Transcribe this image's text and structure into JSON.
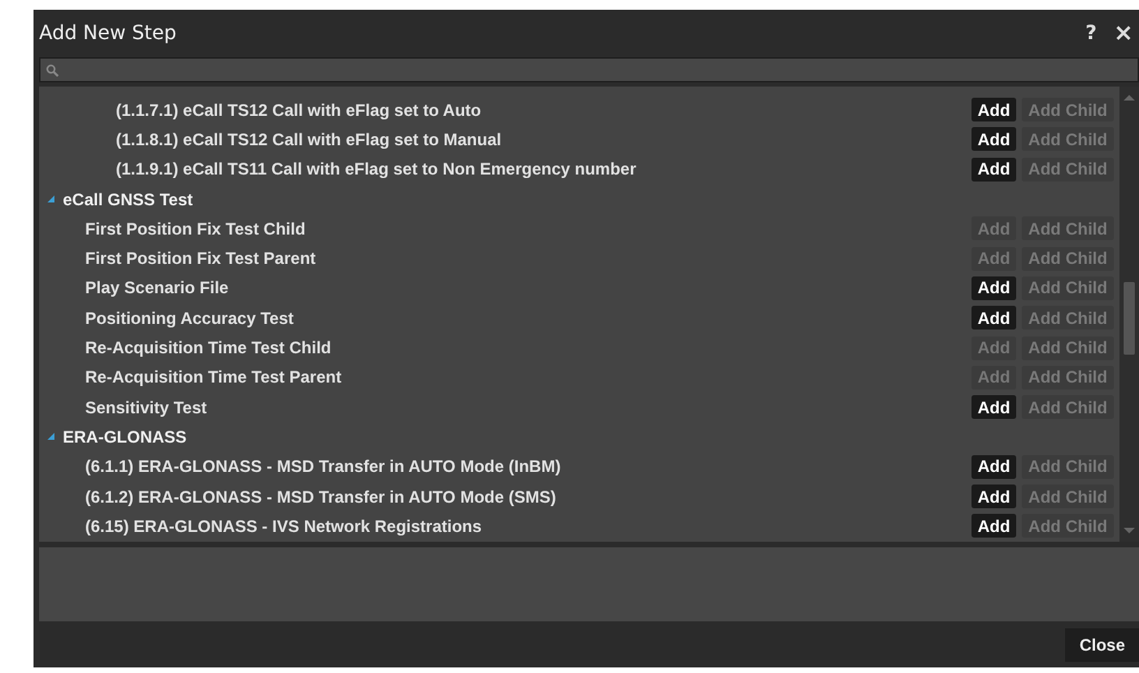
{
  "window": {
    "title": "Add New Step",
    "help": "?",
    "close": "×"
  },
  "tree": [
    {
      "children": [
        {
          "label": "(1.1.7.1) eCall TS12 Call with eFlag set to Auto",
          "add": "Add",
          "add_child": "Add Child",
          "add_disabled": false
        },
        {
          "label": "(1.1.8.1) eCall TS12 Call with eFlag set to Manual",
          "add": "Add",
          "add_child": "Add Child",
          "add_disabled": false
        },
        {
          "label": "(1.1.9.1) eCall TS11 Call with eFlag set to Non Emergency number",
          "add": "Add",
          "add_child": "Add Child",
          "add_disabled": false
        }
      ]
    },
    {
      "label": "eCall GNSS Test",
      "expanded": true,
      "children": [
        {
          "label": "First Position Fix Test Child",
          "add": "Add",
          "add_child": "Add Child",
          "add_disabled": true
        },
        {
          "label": "First Position Fix Test Parent",
          "add": "Add",
          "add_child": "Add Child",
          "add_disabled": true
        },
        {
          "label": "Play Scenario File",
          "add": "Add",
          "add_child": "Add Child",
          "add_disabled": false
        },
        {
          "label": "Positioning Accuracy Test",
          "add": "Add",
          "add_child": "Add Child",
          "add_disabled": false
        },
        {
          "label": "Re-Acquisition Time Test Child",
          "add": "Add",
          "add_child": "Add Child",
          "add_disabled": true
        },
        {
          "label": "Re-Acquisition Time Test Parent",
          "add": "Add",
          "add_child": "Add Child",
          "add_disabled": true
        },
        {
          "label": "Sensitivity Test",
          "add": "Add",
          "add_child": "Add Child",
          "add_disabled": false
        }
      ]
    },
    {
      "label": "ERA-GLONASS",
      "expanded": true,
      "children": [
        {
          "label": "(6.1.1) ERA-GLONASS - MSD Transfer in AUTO Mode (InBM)",
          "add": "Add",
          "add_child": "Add Child",
          "add_disabled": false
        },
        {
          "label": "(6.1.2) ERA-GLONASS - MSD Transfer in AUTO Mode (SMS)",
          "add": "Add",
          "add_child": "Add Child",
          "add_disabled": false
        },
        {
          "label": "(6.15) ERA-GLONASS - IVS Network Registrations",
          "add": "Add",
          "add_child": "Add Child",
          "add_disabled": false
        }
      ]
    }
  ],
  "buttons": {
    "close": "Close"
  }
}
